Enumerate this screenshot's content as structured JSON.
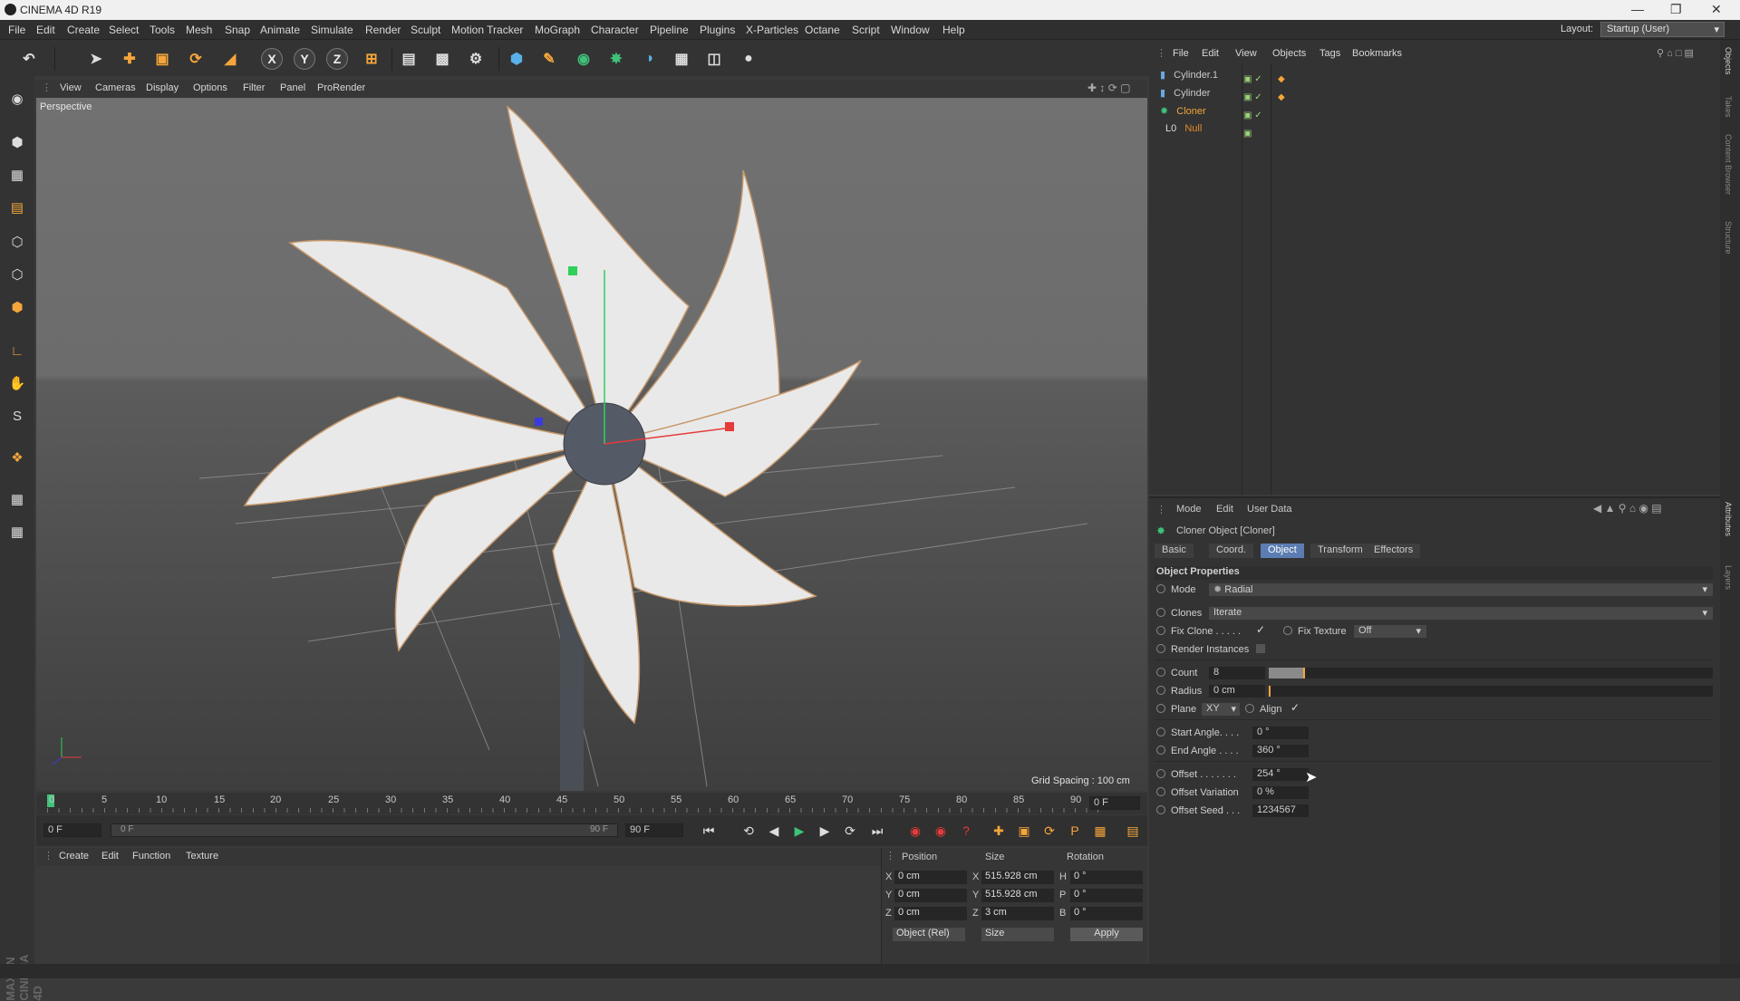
{
  "window": {
    "title": "CINEMA 4D R19"
  },
  "menubar": {
    "items": [
      "File",
      "Edit",
      "Create",
      "Select",
      "Tools",
      "Mesh",
      "Snap",
      "Animate",
      "Simulate",
      "Render",
      "Sculpt",
      "Motion Tracker",
      "MoGraph",
      "Character",
      "Pipeline",
      "Plugins",
      "X-Particles",
      "Octane",
      "Script",
      "Window",
      "Help"
    ],
    "layout_label": "Layout:",
    "layout_value": "Startup (User)"
  },
  "toolbar": {
    "axis_x": "X",
    "axis_y": "Y",
    "axis_z": "Z"
  },
  "viewport": {
    "menu": [
      "View",
      "Cameras",
      "Display",
      "Options",
      "Filter",
      "Panel",
      "ProRender"
    ],
    "label": "Perspective",
    "grid_spacing": "Grid Spacing : 100 cm"
  },
  "timeline": {
    "ticks": [
      "0",
      "5",
      "10",
      "15",
      "20",
      "25",
      "30",
      "35",
      "40",
      "45",
      "50",
      "55",
      "60",
      "65",
      "70",
      "75",
      "80",
      "85",
      "90"
    ],
    "current_frame": "0 F",
    "start_frame": "0 F",
    "range_start": "0 F",
    "range_end": "90 F",
    "end_frame": "90 F"
  },
  "material_manager": {
    "menu": [
      "Create",
      "Edit",
      "Function",
      "Texture"
    ]
  },
  "coordinates": {
    "headers": {
      "position": "Position",
      "size": "Size",
      "rotation": "Rotation"
    },
    "rows": [
      {
        "axis": "X",
        "pos": "0 cm",
        "size_axis": "X",
        "size": "515.928 cm",
        "rot_axis": "H",
        "rot": "0 °"
      },
      {
        "axis": "Y",
        "pos": "0 cm",
        "size_axis": "Y",
        "size": "515.928 cm",
        "rot_axis": "P",
        "rot": "0 °"
      },
      {
        "axis": "Z",
        "pos": "0 cm",
        "size_axis": "Z",
        "size": "3 cm",
        "rot_axis": "B",
        "rot": "0 °"
      }
    ],
    "mode": "Object (Rel)",
    "size_mode": "Size",
    "apply": "Apply"
  },
  "object_manager": {
    "menu": [
      "File",
      "Edit",
      "View",
      "Objects",
      "Tags",
      "Bookmarks"
    ],
    "objects": [
      {
        "name": "Cylinder.1",
        "color": "#c8c8c8"
      },
      {
        "name": "Cylinder",
        "color": "#c8c8c8"
      },
      {
        "name": "Cloner",
        "color": "#f4a53b"
      },
      {
        "name": "Null",
        "color": "#e08a2a"
      }
    ]
  },
  "attributes": {
    "menu": [
      "Mode",
      "Edit",
      "User Data"
    ],
    "title": "Cloner Object [Cloner]",
    "tabs": [
      "Basic",
      "Coord.",
      "Object",
      "Transform",
      "Effectors"
    ],
    "active_tab": "Object",
    "section": "Object Properties",
    "mode_label": "Mode",
    "mode_value": "Radial",
    "clones_label": "Clones",
    "clones_value": "Iterate",
    "fix_clone_label": "Fix Clone . . . . .",
    "fix_texture_label": "Fix Texture",
    "fix_texture_value": "Off",
    "render_instances_label": "Render Instances",
    "count_label": "Count",
    "count_value": "8",
    "radius_label": "Radius",
    "radius_value": "0 cm",
    "plane_label": "Plane",
    "plane_value": "XY",
    "align_label": "Align",
    "start_angle_label": "Start Angle. . . .",
    "start_angle_value": "0 °",
    "end_angle_label": "End Angle . . . .",
    "end_angle_value": "360 °",
    "offset_label": "Offset . . . . . . .",
    "offset_value": "254 °",
    "offset_variation_label": "Offset Variation",
    "offset_variation_value": "0 %",
    "offset_seed_label": "Offset Seed . . .",
    "offset_seed_value": "1234567"
  },
  "right_strip": {
    "tabs": [
      "Objects",
      "Takes",
      "Content Browser",
      "Structure",
      "Attributes",
      "Layers"
    ]
  },
  "branding": {
    "line1": "MAXON",
    "line2": "CINEMA 4D"
  },
  "colors": {
    "accent_orange": "#f4a53b",
    "active_tab_blue": "#5b7db1"
  }
}
